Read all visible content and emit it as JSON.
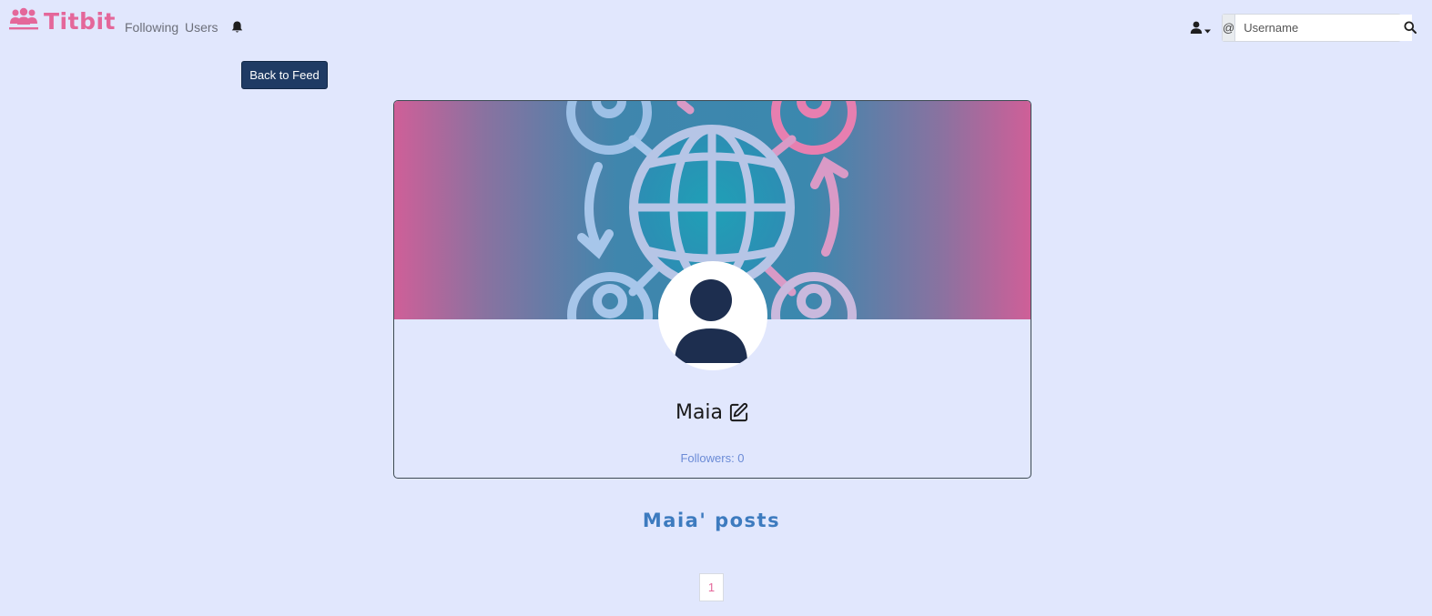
{
  "navbar": {
    "brand": "Titbit",
    "links": [
      "Following",
      "Users"
    ],
    "search": {
      "prefix": "@",
      "placeholder": "Username",
      "value": ""
    }
  },
  "actions": {
    "back_label": "Back to Feed"
  },
  "profile": {
    "name": "Maia",
    "followers_text": "Followers: 0"
  },
  "posts": {
    "title": "Maia' posts"
  },
  "pagination": {
    "current": "1"
  },
  "colors": {
    "background": "#e1e7fd",
    "brand": "#e4679a",
    "button": "#1f3b64",
    "heading": "#3d7bbf",
    "followers": "#6b8bd6"
  },
  "icons": {
    "brand": "users-icon",
    "notifications": "bell-icon",
    "user_menu": "user-icon",
    "search": "search-icon",
    "edit": "edit-icon",
    "avatar": "user-avatar-icon",
    "banner": "global-network-icon"
  }
}
